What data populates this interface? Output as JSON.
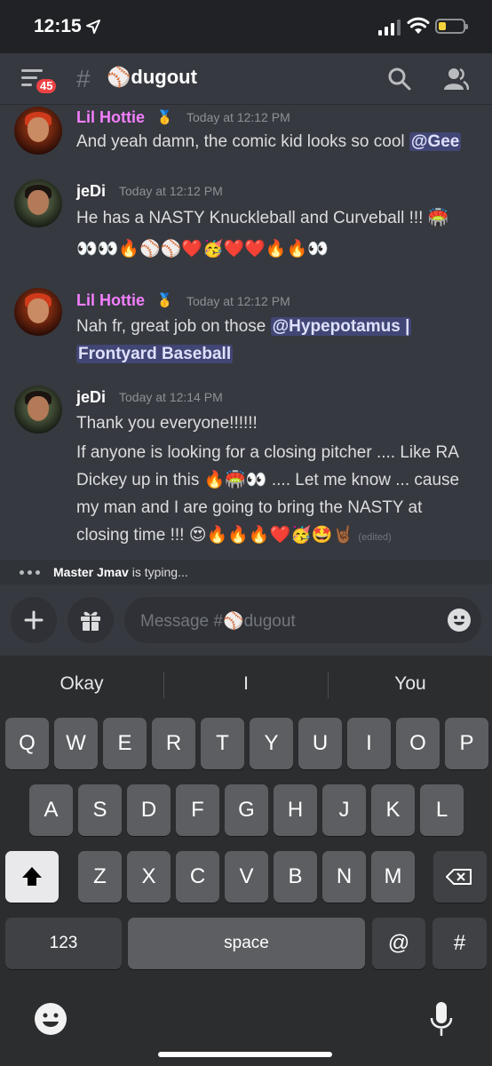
{
  "status_bar": {
    "time": "12:15",
    "battery_level": 0.3,
    "battery_color": "#f5d13b"
  },
  "header": {
    "badge_count": "45",
    "channel_name": "⚾dugout"
  },
  "messages": [
    {
      "author": "Lil Hottie",
      "author_color": "#f47fff",
      "medal": "🥇",
      "time": "Today at 12:12 PM",
      "text": "And yeah damn, the comic kid looks so cool ",
      "mention": "@Gee"
    },
    {
      "author": "jeDi",
      "author_color": "#ffffff",
      "time": "Today at 12:12 PM",
      "line1": "He has a NASTY Knuckleball and Curveball !!! 🏟️",
      "line2": "👀👀🔥⚾⚾❤️🥳❤️❤️🔥🔥👀"
    },
    {
      "author": "Lil Hottie",
      "author_color": "#f47fff",
      "medal": "🥇",
      "time": "Today at 12:12 PM",
      "text": "Nah fr, great job on those ",
      "mention_line1": "@Hypepotamus |",
      "mention_line2": "Frontyard Baseball"
    },
    {
      "author": "jeDi",
      "author_color": "#ffffff",
      "time": "Today at 12:14 PM",
      "line1": "Thank you everyone!!!!!!",
      "line2": "If anyone is looking for a closing pitcher .... Like RA",
      "line3": "Dickey up in this 🔥🏟️👀 .... Let me know ... cause",
      "line4": "my man and I are going to bring the NASTY at",
      "line5": "closing time !!! 😍🔥🔥🔥❤️🥳🤩🤘🏾",
      "edited": "(edited)"
    }
  ],
  "typing": {
    "user": "Master Jmav",
    "suffix": " is typing..."
  },
  "composer": {
    "placeholder": "Message #⚾dugout"
  },
  "keyboard": {
    "suggestions": [
      "Okay",
      "I",
      "You"
    ],
    "row1": [
      "Q",
      "W",
      "E",
      "R",
      "T",
      "Y",
      "U",
      "I",
      "O",
      "P"
    ],
    "row2": [
      "A",
      "S",
      "D",
      "F",
      "G",
      "H",
      "J",
      "K",
      "L"
    ],
    "row3": [
      "Z",
      "X",
      "C",
      "V",
      "B",
      "N",
      "M"
    ],
    "numbers_key": "123",
    "space_key": "space",
    "at_key": "@",
    "hash_key": "#"
  }
}
